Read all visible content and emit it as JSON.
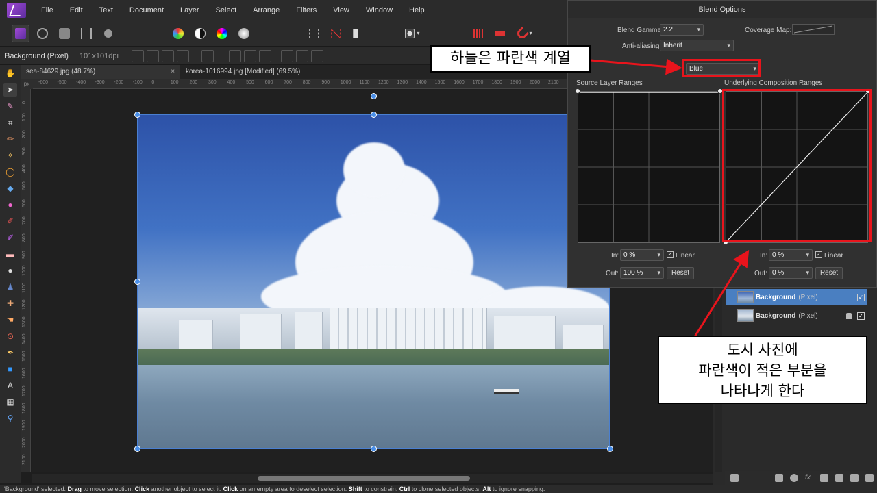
{
  "menu": [
    "File",
    "Edit",
    "Text",
    "Document",
    "Layer",
    "Select",
    "Arrange",
    "Filters",
    "View",
    "Window",
    "Help"
  ],
  "context": {
    "layer": "Background (Pixel)",
    "dpi": "101x101dpi"
  },
  "tabs": [
    {
      "label": "sea-84629.jpg (48.7%)",
      "close": "×"
    },
    {
      "label": "korea-1016994.jpg [Modified] (69.5%)"
    }
  ],
  "ruler": {
    "unit": "px",
    "h_ticks": [
      "-600",
      "-500",
      "-400",
      "-300",
      "-200",
      "-100",
      "0",
      "100",
      "200",
      "300",
      "400",
      "500",
      "600",
      "700",
      "800",
      "900",
      "1000",
      "1100",
      "1200",
      "1300",
      "1400",
      "1500",
      "1600",
      "1700",
      "1800",
      "1900",
      "2000",
      "2100",
      "2200",
      "2300",
      "2400",
      "2500",
      "2600",
      "2700",
      "2800",
      "2900"
    ],
    "v_ticks": [
      "0",
      "100",
      "200",
      "300",
      "400",
      "500",
      "600",
      "700",
      "800",
      "900",
      "1000",
      "1100",
      "1200",
      "1300",
      "1400",
      "1500",
      "1600",
      "1700",
      "1800",
      "1900",
      "2000",
      "2100"
    ]
  },
  "dialog": {
    "title": "Blend Options",
    "blend_gamma_label": "Blend Gamma:",
    "blend_gamma_value": "2.2",
    "coverage_label": "Coverage Map:",
    "antialias_label": "Anti-aliasing:",
    "antialias_value": "Inherit",
    "channel_value": "Blue",
    "source_label": "Source Layer Ranges",
    "underlying_label": "Underlying Composition Ranges",
    "left": {
      "in_label": "In:",
      "in_value": "0 %",
      "out_label": "Out:",
      "out_value": "100 %",
      "linear": "Linear",
      "reset": "Reset"
    },
    "right": {
      "in_label": "In:",
      "in_value": "0 %",
      "out_label": "Out:",
      "out_value": "0 %",
      "linear": "Linear",
      "reset": "Reset"
    }
  },
  "layers": [
    {
      "name": "Background",
      "type": "(Pixel)",
      "selected": true
    },
    {
      "name": "Background",
      "type": "(Pixel)",
      "selected": false
    }
  ],
  "status": {
    "pre": "'Background' selected. ",
    "drag": "Drag",
    "t1": " to move selection. ",
    "click": "Click",
    "t2": " another object to select it. ",
    "click2": "Click",
    "t3": " on an empty area to deselect selection. ",
    "shift": "Shift",
    "t4": " to constrain. ",
    "ctrl": "Ctrl",
    "t5": " to clone selected objects. ",
    "alt": "Alt",
    "t6": " to ignore snapping."
  },
  "annotations": {
    "top": "하늘은 파란색 계열",
    "bottom_line1": "도시 사진에",
    "bottom_line2": "파란색이 적은 부분을",
    "bottom_line3": "나타나게 한다"
  },
  "colors": {
    "highlight": "#e8141c",
    "selection": "#4a7fc1"
  }
}
